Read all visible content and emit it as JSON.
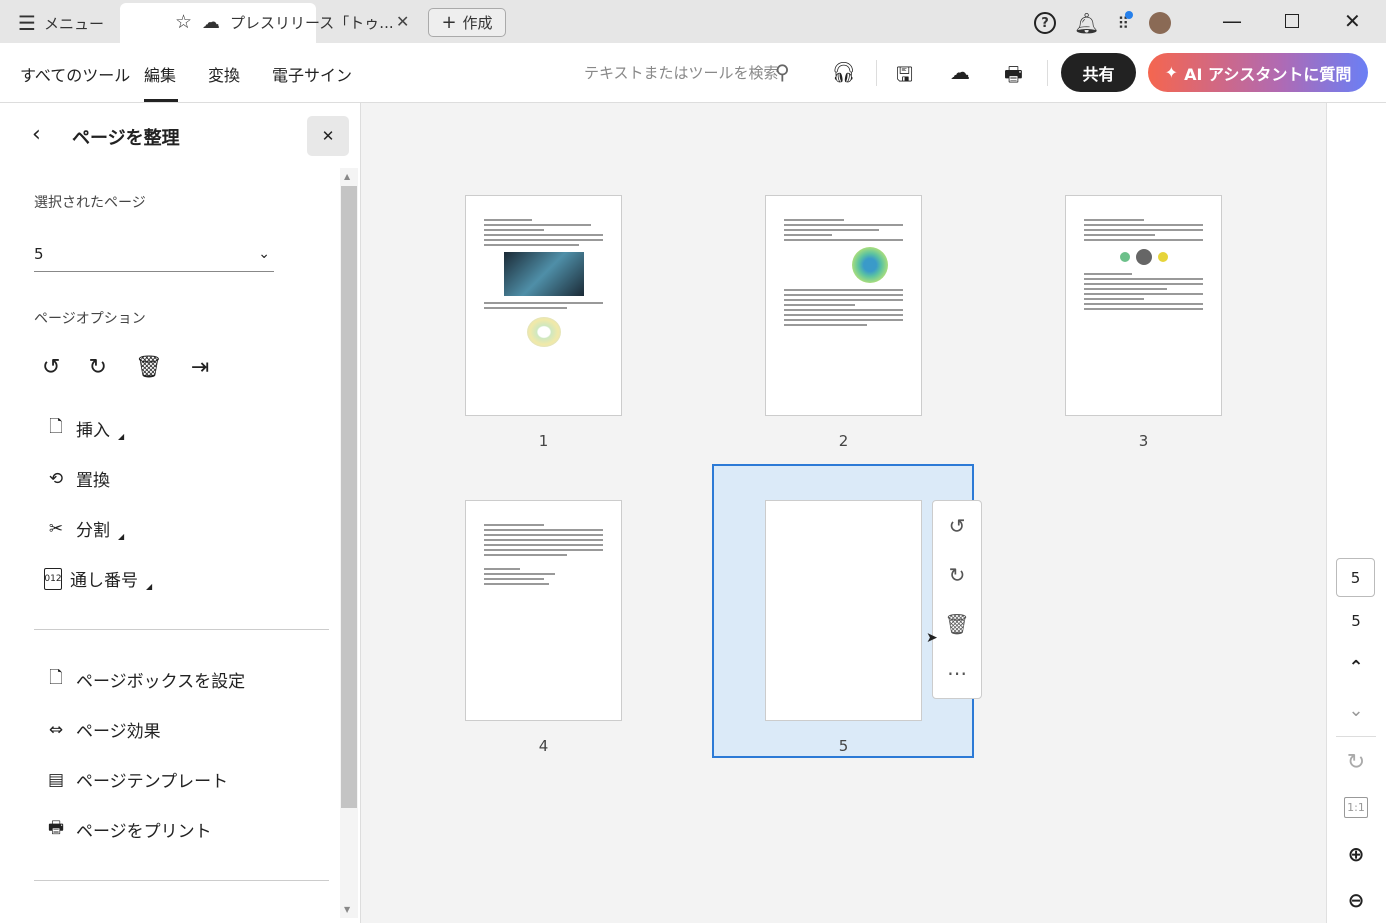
{
  "titlebar": {
    "menu_label": "メニュー",
    "tab_title": "プレスリリース「トゥ...",
    "create_label": "作成"
  },
  "toolbar": {
    "nav": [
      "すべてのツール",
      "編集",
      "変換",
      "電子サイン"
    ],
    "active_nav": "編集",
    "search_placeholder": "テキストまたはツールを検索",
    "share_label": "共有",
    "ai_label": "AI アシスタントに質問"
  },
  "panel": {
    "title": "ページを整理",
    "selected_pages_label": "選択されたページ",
    "selected_pages_value": "5",
    "page_options_label": "ページオプション",
    "items": [
      "挿入",
      "置換",
      "分割",
      "通し番号"
    ],
    "more_items": [
      "ページボックスを設定",
      "ページ効果",
      "ページテンプレート",
      "ページをプリント"
    ]
  },
  "pages": [
    {
      "label": "1"
    },
    {
      "label": "2"
    },
    {
      "label": "3"
    },
    {
      "label": "4"
    },
    {
      "label": "5",
      "selected": true,
      "blank": true
    }
  ],
  "rail": {
    "page_input": "5",
    "total_pages": "5"
  },
  "colors": {
    "selection": "#2c7ad6",
    "selection_bg": "#dbeaf8",
    "share_bg": "#222222"
  }
}
